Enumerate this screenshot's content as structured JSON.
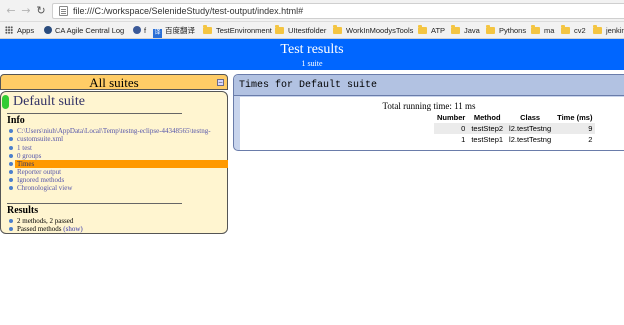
{
  "browser": {
    "url": "file:///C:/workspace/SelenideStudy/test-output/index.html#",
    "bookmarks": [
      {
        "label": "Apps",
        "icon": "apps-grid-icon"
      },
      {
        "label": "CA Agile Central Log",
        "icon": "ca-logo-icon"
      },
      {
        "label": "f",
        "icon": "facebook-icon"
      },
      {
        "label": "百度翻译",
        "icon": "translate-icon"
      },
      {
        "label": "TestEnvironment",
        "icon": "folder-icon"
      },
      {
        "label": "UItestfolder",
        "icon": "folder-icon"
      },
      {
        "label": "WorkInMoodysTools",
        "icon": "folder-icon"
      },
      {
        "label": "ATP",
        "icon": "folder-icon"
      },
      {
        "label": "Java",
        "icon": "folder-icon"
      },
      {
        "label": "Pythons",
        "icon": "folder-icon"
      },
      {
        "label": "ma",
        "icon": "folder-icon"
      },
      {
        "label": "cv2",
        "icon": "folder-icon"
      },
      {
        "label": "jenkins",
        "icon": "folder-icon"
      }
    ]
  },
  "report": {
    "title": "Test results",
    "subtitle": "1 suite",
    "colors": {
      "header": "#0066ff",
      "navigator": "#fff5d0",
      "selected": "#ff9900",
      "pass": "#33cc33",
      "panel": "#c8d4ec"
    }
  },
  "navigator": {
    "header": "All suites",
    "collapse": "−",
    "suite_name": "Default suite",
    "info_title": "Info",
    "info_items": [
      {
        "label": "C:\\Users\\niuh\\AppData\\Local\\Temp\\testng-eclipse-44348565\\testng-",
        "continuation": "customsuite.xml"
      },
      {
        "label": "1 test"
      },
      {
        "label": "0 groups"
      },
      {
        "label": "Times",
        "selected": true
      },
      {
        "label": "Reporter output"
      },
      {
        "label": "Ignored methods"
      },
      {
        "label": "Chronological view"
      }
    ],
    "results_title": "Results",
    "results_items": [
      {
        "label": "2 methods, 2 passed"
      },
      {
        "label": "Passed methods",
        "link": "(show)"
      }
    ]
  },
  "main": {
    "title": "Times for Default suite",
    "running_time": "Total running time: 11 ms",
    "table": {
      "headers": [
        "Number",
        "Method",
        "Class",
        "Time (ms)"
      ],
      "rows": [
        [
          "0",
          "testStep2",
          "l2.testTestng",
          "9"
        ],
        [
          "1",
          "testStep1",
          "l2.testTestng",
          "2"
        ]
      ]
    }
  }
}
